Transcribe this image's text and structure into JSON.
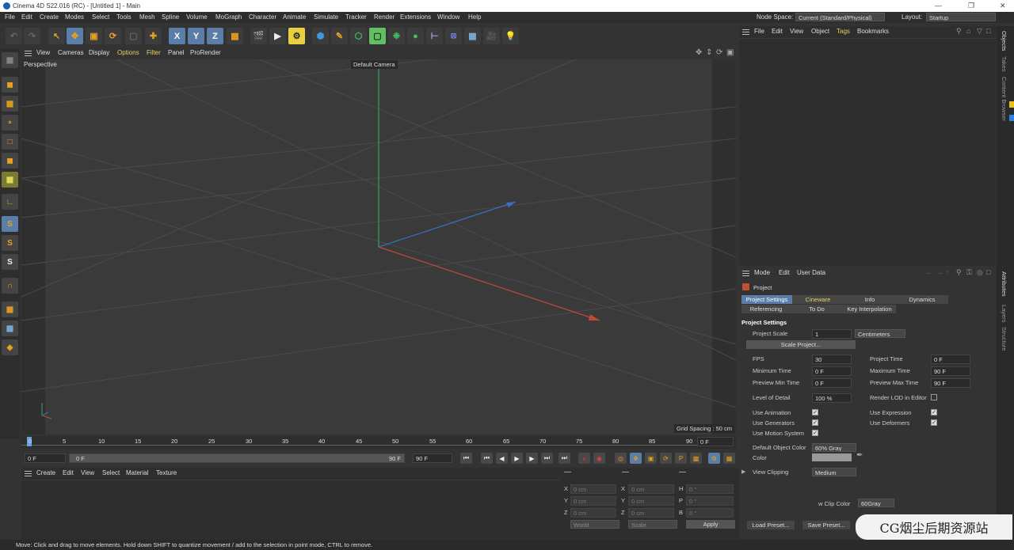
{
  "title": "Cinema 4D S22.016 (RC) - [Untitled 1] - Main",
  "menu": [
    "File",
    "Edit",
    "Create",
    "Modes",
    "Select",
    "Tools",
    "Mesh",
    "Spline",
    "Volume",
    "MoGraph",
    "Character",
    "Animate",
    "Simulate",
    "Tracker",
    "Render",
    "Extensions",
    "Window",
    "Help"
  ],
  "node_space_label": "Node Space:",
  "node_space_value": "Current (Standard/Physical)",
  "layout_label": "Layout:",
  "layout_value": "Startup",
  "axis_buttons": [
    "X",
    "Y",
    "Z"
  ],
  "viewport_menu": [
    "View",
    "Cameras",
    "Display",
    "Options",
    "Filter",
    "Panel",
    "ProRender"
  ],
  "viewport_label": "Perspective",
  "camera_label": "Default Camera",
  "grid_spacing": "Grid Spacing : 50 cm",
  "timeline_ticks": [
    "0",
    "5",
    "10",
    "15",
    "20",
    "25",
    "30",
    "35",
    "40",
    "45",
    "50",
    "55",
    "60",
    "65",
    "70",
    "75",
    "80",
    "85",
    "90"
  ],
  "timeline_end": "0 F",
  "transport": {
    "start": "0 F",
    "current": "0 F",
    "end": "90 F",
    "max": "90 F"
  },
  "material_menu": [
    "Create",
    "Edit",
    "View",
    "Select",
    "Material",
    "Texture"
  ],
  "coords": {
    "rows": [
      {
        "a": "X",
        "av": "0 cm",
        "b": "X",
        "bv": "0 cm",
        "c": "H",
        "cv": "0 °"
      },
      {
        "a": "Y",
        "av": "0 cm",
        "b": "Y",
        "bv": "0 cm",
        "c": "P",
        "cv": "0 °"
      },
      {
        "a": "Z",
        "av": "0 cm",
        "b": "Z",
        "bv": "0 cm",
        "c": "B",
        "cv": "0 °"
      }
    ],
    "mode1": "World",
    "mode2": "Scale",
    "apply": "Apply"
  },
  "object_menu": [
    "File",
    "Edit",
    "View",
    "Object",
    "Tags",
    "Bookmarks"
  ],
  "attr_menu": [
    "Mode",
    "Edit",
    "User Data"
  ],
  "attr": {
    "object_name": "Project",
    "tabs_row1": [
      "Project Settings",
      "Cineware",
      "Info",
      "Dynamics"
    ],
    "tabs_row2": [
      "Referencing",
      "To Do",
      "Key Interpolation"
    ],
    "section": "Project Settings",
    "project_scale_label": "Project Scale",
    "project_scale_value": "1",
    "project_scale_unit": "Centimeters",
    "scale_project_btn": "Scale Project...",
    "left_fields": [
      {
        "label": "FPS",
        "value": "30"
      },
      {
        "label": "Minimum Time",
        "value": "0 F"
      },
      {
        "label": "Preview Min Time",
        "value": "0 F"
      }
    ],
    "right_fields": [
      {
        "label": "Project Time",
        "value": "0 F"
      },
      {
        "label": "Maximum Time",
        "value": "90 F"
      },
      {
        "label": "Preview Max Time",
        "value": "90 F"
      }
    ],
    "lod_label": "Level of Detail",
    "lod_value": "100 %",
    "render_lod": "Render LOD in Editor",
    "checks_left": [
      "Use Animation",
      "Use Generators",
      "Use Motion System"
    ],
    "checks_right": [
      "Use Expression",
      "Use Deformers"
    ],
    "default_color_label": "Default Object Color",
    "default_color_value": "60% Gray",
    "color_label": "Color",
    "view_clipping_label": "View Clipping",
    "view_clipping_value": "Medium",
    "clip_color_label": "w Clip Color",
    "clip_color_value": "60Gray",
    "load_preset": "Load Preset...",
    "save_preset": "Save Preset..."
  },
  "right_tabs_top": [
    "Objects",
    "Takes",
    "Content Browser"
  ],
  "right_tabs_bottom": [
    "Attributes",
    "Layers",
    "Structure"
  ],
  "status": "Move: Click and drag to move elements. Hold down SHIFT to quantize movement / add to the selection in point mode, CTRL to remove.",
  "watermark": "CG烟尘后期资源站",
  "colors": {
    "accent": "#5a7ea8",
    "x_axis": "#c04a3a",
    "y_axis": "#3aa060",
    "z_axis": "#3a6ec0",
    "orange": "#e8a020"
  }
}
